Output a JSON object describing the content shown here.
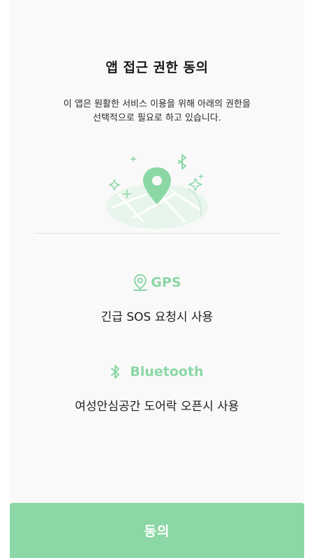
{
  "title": "앱 접근 권한 동의",
  "description": {
    "line1": "이 앱은 원활한 서비스 이용을 위해 아래의 권한을",
    "line2": "선택적으로 필요로 하고 있습니다."
  },
  "permissions": [
    {
      "name": "GPS",
      "icon": "location-pin-icon",
      "usage": "긴급 SOS 요청시 사용"
    },
    {
      "name": "Bluetooth",
      "icon": "bluetooth-icon",
      "usage": "여성안심공간 도어락 오픈시 사용"
    }
  ],
  "agree_button": {
    "label": "동의"
  },
  "colors": {
    "accent": "#8bd7a5",
    "card_background": "#f9f9f9",
    "text": "#1f1f1f"
  }
}
